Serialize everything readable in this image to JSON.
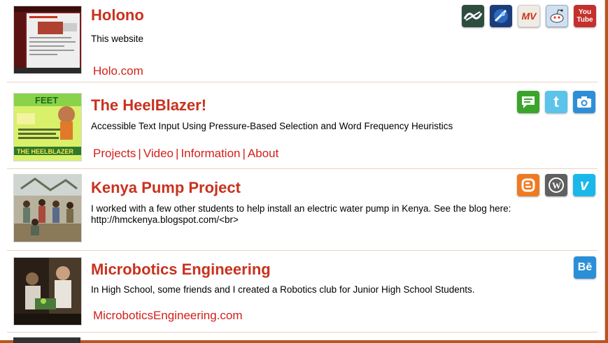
{
  "colors": {
    "accent": "#c8321e",
    "link": "#d2201a",
    "frame": "#b9551f"
  },
  "projects": [
    {
      "title": "Holono",
      "description": "This website",
      "links": [
        "Holo.com"
      ],
      "icons": [
        "dreamweaver-icon",
        "satellite-icon",
        "mv-icon",
        "reddit-icon",
        "youtube-icon"
      ],
      "icon_text": {
        "mv": "MV",
        "you": "You",
        "tube": "Tube"
      }
    },
    {
      "title": "The HeelBlazer!",
      "description": "Accessible Text Input Using Pressure-Based Selection and Word Frequency Heuristics",
      "links": [
        "Projects",
        "Video",
        "Information",
        "About"
      ],
      "icons": [
        "chat-icon",
        "twitter-icon",
        "camera-icon"
      ],
      "thumb_text": {
        "top": "FEET",
        "bottom": "THE HEELBLAZER"
      }
    },
    {
      "title": "Kenya Pump Project",
      "description": "I worked with a few other students to help install an electric water pump in Kenya. See the blog here: http://hmckenya.blogspot.com/<br>",
      "links": [],
      "icons": [
        "blogger-icon",
        "wordpress-icon",
        "vimeo-icon"
      ]
    },
    {
      "title": "Microbotics Engineering",
      "description": "In High School, some friends and I created a Robotics club for Junior High School Students.",
      "links": [
        "MicroboticsEngineering.com"
      ],
      "icons": [
        "behance-icon"
      ],
      "icon_text": {
        "be": "Bē"
      }
    }
  ]
}
